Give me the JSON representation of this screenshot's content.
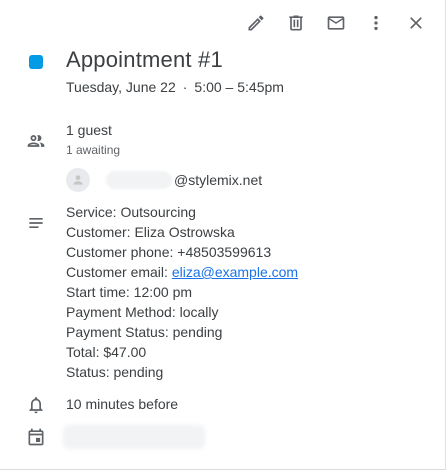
{
  "toolbar": {
    "edit_icon": "pencil-icon",
    "delete_icon": "trash-icon",
    "email_icon": "mail-icon",
    "more_icon": "more-vert-icon",
    "close_icon": "close-icon"
  },
  "event": {
    "color": "#039be5",
    "title": "Appointment #1",
    "date": "Tuesday, June 22",
    "separator": "·",
    "time": "5:00 – 5:45pm"
  },
  "guests": {
    "count_label": "1 guest",
    "status_label": "1 awaiting",
    "list": [
      {
        "email_domain": "@stylemix.net"
      }
    ]
  },
  "description": {
    "service": "Service: Outsourcing",
    "customer": "Customer: Eliza Ostrowska",
    "phone": "Customer phone: +48503599613",
    "email_prefix": "Customer email: ",
    "email_link": "eliza@example.com",
    "start_time": "Start time: 12:00 pm",
    "payment_method": "Payment Method: locally",
    "payment_status": "Payment Status: pending",
    "total": "Total: $47.00",
    "status": "Status: pending"
  },
  "reminder": {
    "label": "10 minutes before"
  }
}
